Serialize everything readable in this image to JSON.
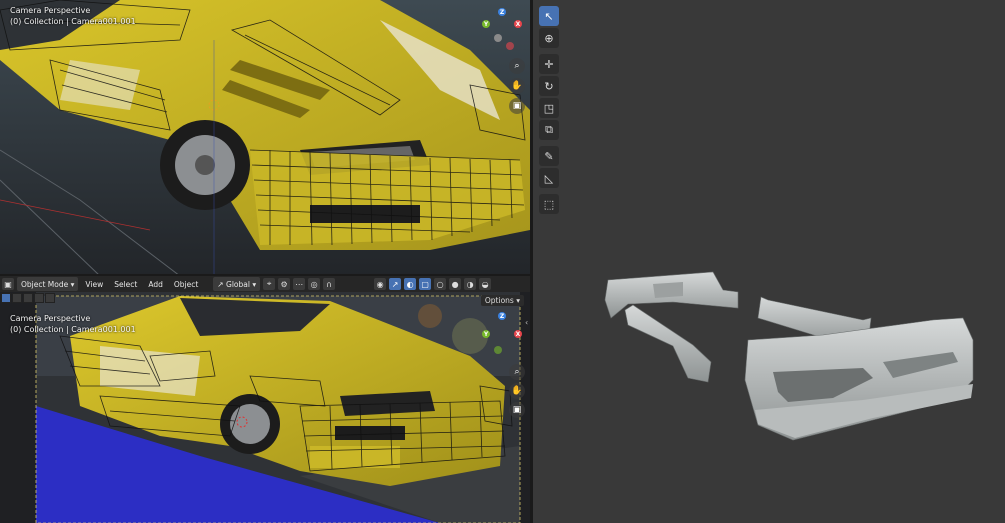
{
  "top_viewport": {
    "title": "Camera Perspective",
    "collection": "(0) Collection | Camera001.001"
  },
  "bottom_viewport": {
    "title": "Camera Perspective",
    "collection": "(0) Collection | Camera001.001",
    "header": {
      "mode": "Object Mode",
      "menus": [
        "View",
        "Select",
        "Add",
        "Object"
      ],
      "orientation": "Global"
    },
    "options_label": "Options"
  },
  "navigation_gizmo": {
    "axes": [
      "X",
      "Y",
      "Z"
    ]
  },
  "toolbar": {
    "tools": [
      "select-box",
      "cursor",
      "move",
      "rotate",
      "scale",
      "transform",
      "annotate",
      "measure",
      "add-cube"
    ]
  },
  "colors": {
    "accent": "#4772b3",
    "axis_x": "#e8454c",
    "axis_y": "#76b82a",
    "axis_z": "#3b82e0",
    "car_body": "#d8c21e",
    "parts": "#b8bcbc"
  }
}
